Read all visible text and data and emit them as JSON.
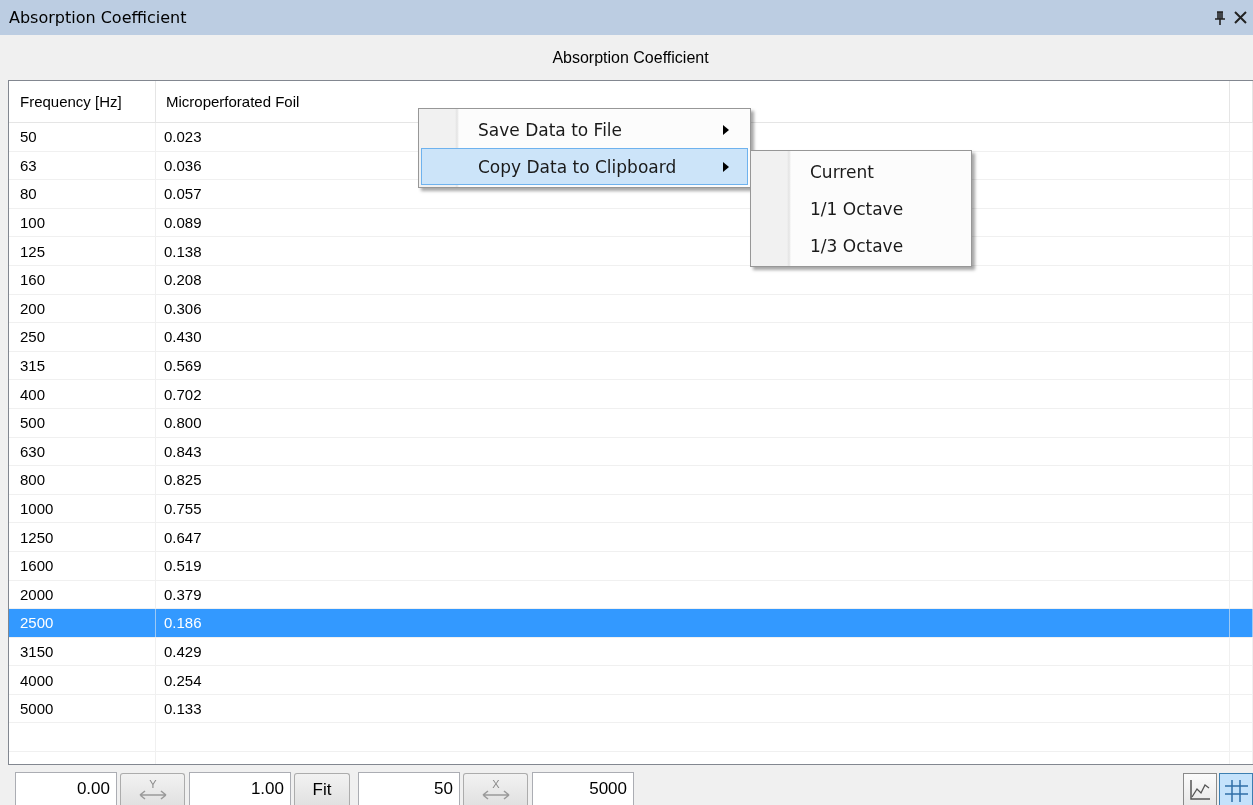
{
  "panel": {
    "title": "Absorption Coefficient"
  },
  "chart_title": "Absorption Coefficient",
  "table": {
    "columns": [
      "Frequency [Hz]",
      "Microperforated Foil"
    ],
    "rows": [
      {
        "cells": [
          "50",
          "0.023"
        ],
        "selected": false
      },
      {
        "cells": [
          "63",
          "0.036"
        ],
        "selected": false
      },
      {
        "cells": [
          "80",
          "0.057"
        ],
        "selected": false
      },
      {
        "cells": [
          "100",
          "0.089"
        ],
        "selected": false
      },
      {
        "cells": [
          "125",
          "0.138"
        ],
        "selected": false
      },
      {
        "cells": [
          "160",
          "0.208"
        ],
        "selected": false
      },
      {
        "cells": [
          "200",
          "0.306"
        ],
        "selected": false
      },
      {
        "cells": [
          "250",
          "0.430"
        ],
        "selected": false
      },
      {
        "cells": [
          "315",
          "0.569"
        ],
        "selected": false
      },
      {
        "cells": [
          "400",
          "0.702"
        ],
        "selected": false
      },
      {
        "cells": [
          "500",
          "0.800"
        ],
        "selected": false
      },
      {
        "cells": [
          "630",
          "0.843"
        ],
        "selected": false
      },
      {
        "cells": [
          "800",
          "0.825"
        ],
        "selected": false
      },
      {
        "cells": [
          "1000",
          "0.755"
        ],
        "selected": false
      },
      {
        "cells": [
          "1250",
          "0.647"
        ],
        "selected": false
      },
      {
        "cells": [
          "1600",
          "0.519"
        ],
        "selected": false
      },
      {
        "cells": [
          "2000",
          "0.379"
        ],
        "selected": false
      },
      {
        "cells": [
          "2500",
          "0.186"
        ],
        "selected": true
      },
      {
        "cells": [
          "3150",
          "0.429"
        ],
        "selected": false
      },
      {
        "cells": [
          "4000",
          "0.254"
        ],
        "selected": false
      },
      {
        "cells": [
          "5000",
          "0.133"
        ],
        "selected": false
      }
    ]
  },
  "context_menu": {
    "items": [
      {
        "label": "Save Data to File",
        "selected": false,
        "has_submenu": true
      },
      {
        "label": "Copy Data to Clipboard",
        "selected": true,
        "has_submenu": true
      }
    ]
  },
  "submenu": {
    "items": [
      {
        "label": "Current",
        "selected": false
      },
      {
        "label": "1/1 Octave",
        "selected": false
      },
      {
        "label": "1/3 Octave",
        "selected": false
      }
    ]
  },
  "axis_controls": [
    {
      "kind": "field",
      "value": "0.00"
    },
    {
      "kind": "scale-button",
      "axis": "Y"
    },
    {
      "kind": "field",
      "value": "1.00"
    },
    {
      "kind": "button",
      "label": "Fit"
    },
    {
      "kind": "field",
      "value": "50"
    },
    {
      "kind": "scale-button",
      "axis": "X"
    },
    {
      "kind": "field",
      "value": "5000"
    }
  ],
  "view_toggles": [
    {
      "kind": "chart",
      "selected": false
    },
    {
      "kind": "grid",
      "selected": true
    }
  ]
}
